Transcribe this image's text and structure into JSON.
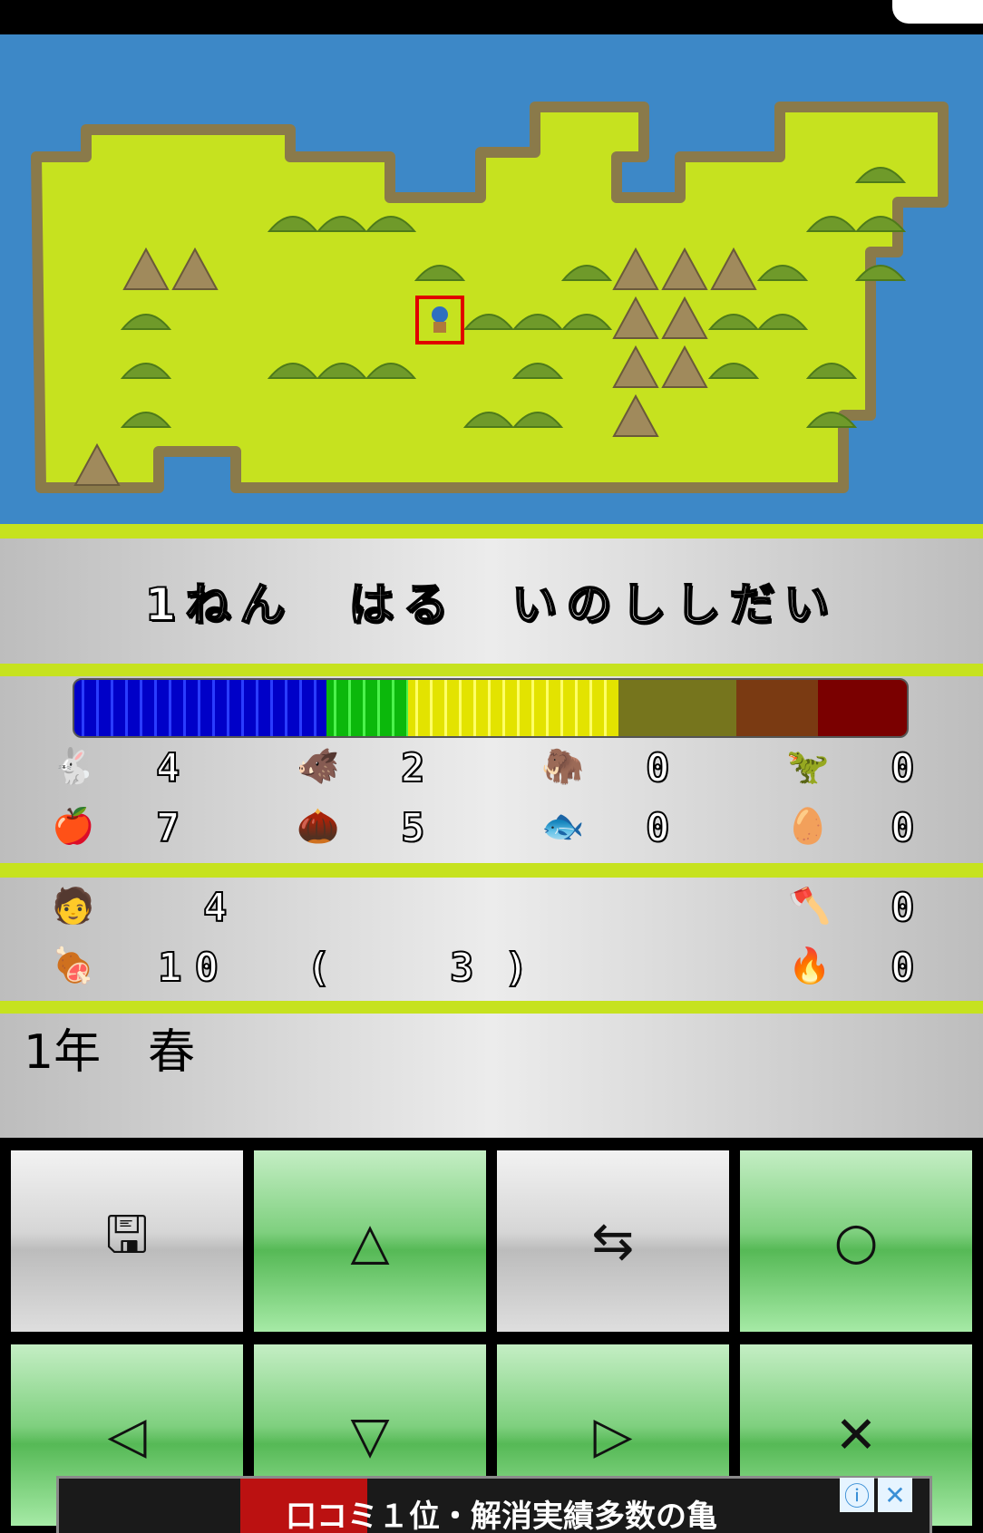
{
  "map": {
    "hills": [
      [
        5,
        3
      ],
      [
        6,
        3
      ],
      [
        7,
        3
      ],
      [
        16,
        3
      ],
      [
        17,
        3
      ],
      [
        8,
        4
      ],
      [
        11,
        4
      ],
      [
        15,
        4
      ],
      [
        17,
        4
      ],
      [
        2,
        5
      ],
      [
        9,
        5
      ],
      [
        10,
        5
      ],
      [
        11,
        5
      ],
      [
        14,
        5
      ],
      [
        15,
        5
      ],
      [
        2,
        6
      ],
      [
        5,
        6
      ],
      [
        6,
        6
      ],
      [
        7,
        6
      ],
      [
        10,
        6
      ],
      [
        14,
        6
      ],
      [
        16,
        6
      ],
      [
        2,
        7
      ],
      [
        9,
        7
      ],
      [
        10,
        7
      ],
      [
        16,
        7
      ],
      [
        17,
        2
      ]
    ],
    "mountains": [
      [
        2,
        4
      ],
      [
        3,
        4
      ],
      [
        12,
        4
      ],
      [
        13,
        4
      ],
      [
        14,
        4
      ],
      [
        12,
        5
      ],
      [
        13,
        5
      ],
      [
        12,
        6
      ],
      [
        13,
        6
      ],
      [
        12,
        7
      ],
      [
        1,
        8
      ]
    ],
    "player_tile": [
      8,
      5
    ]
  },
  "message": "1ねん　はる　いのししだい",
  "progress": {
    "segments": [
      "blue",
      "green",
      "yellow",
      "olive",
      "brown",
      "red"
    ]
  },
  "food_stats": [
    {
      "icon": "rabbit-icon",
      "glyph": "🐇",
      "value": "4"
    },
    {
      "icon": "boar-icon",
      "glyph": "🐗",
      "value": "2"
    },
    {
      "icon": "mammoth-icon",
      "glyph": "🦣",
      "value": "0"
    },
    {
      "icon": "dinosaur-icon",
      "glyph": "🦖",
      "value": "0"
    },
    {
      "icon": "apple-icon",
      "glyph": "🍎",
      "value": "7"
    },
    {
      "icon": "walnut-icon",
      "glyph": "🌰",
      "value": "5"
    },
    {
      "icon": "fish-icon",
      "glyph": "🐟",
      "value": "0"
    },
    {
      "icon": "egg-icon",
      "glyph": "🥚",
      "value": "0"
    }
  ],
  "party": {
    "people_icon": "caveman-icon",
    "people_glyph": "🧑",
    "people": "4",
    "food_icon": "food-pile-icon",
    "food_glyph": "🍖",
    "food_total": "10",
    "food_paren_open": "(",
    "food_reserve": "3",
    "food_paren_close": ")",
    "axe_icon": "axe-icon",
    "axe_glyph": "🪓",
    "axes": "0",
    "fire_icon": "fire-icon",
    "fire_glyph": "🔥",
    "fire": "0"
  },
  "status_text": "1年　春",
  "buttons": {
    "save": "🖫",
    "triangle": "△",
    "swap": "⇆",
    "circle": "○",
    "left": "◁",
    "down": "▽",
    "right": "▷",
    "cross": "✕"
  },
  "ad": {
    "text": "口コミ１位・解消実績多数の亀",
    "info": "ⓘ",
    "close": "✕"
  }
}
